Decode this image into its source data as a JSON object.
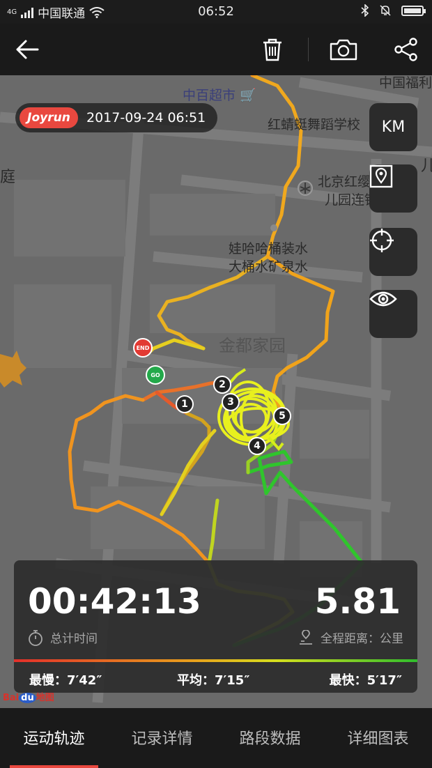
{
  "status_bar": {
    "network": "4G",
    "carrier": "中国联通",
    "time": "06:52",
    "icons": [
      "signal-icon",
      "wifi-icon",
      "bluetooth-icon",
      "mute-icon",
      "battery-icon"
    ],
    "battery_level": 0.9
  },
  "toolbar": {
    "icons": [
      "back-arrow-icon",
      "trash-icon",
      "camera-icon",
      "share-icon"
    ]
  },
  "map": {
    "labels": {
      "supermarket": "中百超市",
      "lottery": "中国福利",
      "dance_school": "红蜻蜓舞蹈学校",
      "ting": "庭",
      "kindergarten_1": "北京红缨幼",
      "kindergarten_2": "儿园连锁",
      "water_1": "娃哈哈桶装水",
      "water_2": "大桶水矿泉水",
      "community": "金都家园",
      "edge": "儿"
    },
    "stamp": {
      "brand": "Joyrun",
      "datetime": "2017-09-24 06:51"
    },
    "side_buttons": {
      "unit": "KM",
      "icons": [
        "map-pin-icon",
        "locate-icon",
        "eye-icon"
      ]
    },
    "markers": {
      "end": "END",
      "go": "GO",
      "km": [
        "1",
        "2",
        "3",
        "4",
        "5"
      ]
    }
  },
  "stats": {
    "duration": "00:42:13",
    "duration_label": "总计时间",
    "distance": "5.81",
    "distance_label": "全程距离：公里",
    "slowest": "最慢：7′42″",
    "average": "平均：7′15″",
    "fastest": "最快：5′17″",
    "pace_colors": [
      "#e32f2a",
      "#e8a21c",
      "#d6df1e",
      "#2fbd2c"
    ]
  },
  "watermark": {
    "baidu": "Bai",
    "du": "du",
    "map_word": "地图"
  },
  "tabs": [
    "运动轨迹",
    "记录详情",
    "路段数据",
    "详细图表"
  ],
  "active_tab": 0
}
